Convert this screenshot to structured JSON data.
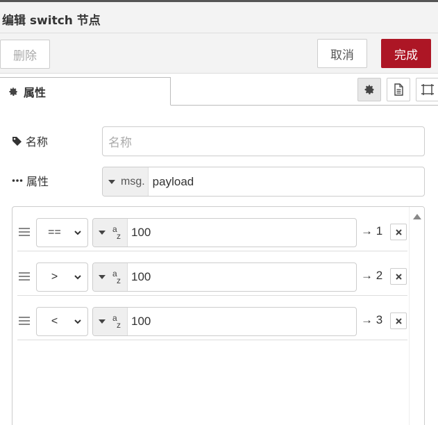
{
  "dialog": {
    "title": "编辑 switch 节点"
  },
  "toolbar": {
    "delete_label": "删除",
    "cancel_label": "取消",
    "done_label": "完成"
  },
  "tabs": {
    "properties_label": "属性"
  },
  "form": {
    "name_label": "名称",
    "name_placeholder": "名称",
    "property_label": "属性",
    "property_prefix": "msg.",
    "property_value": "payload"
  },
  "rules": [
    {
      "operator": "==",
      "type": "a-z",
      "value": "100",
      "output": "→ 1"
    },
    {
      "operator": ">",
      "type": "a-z",
      "value": "100",
      "output": "→ 2"
    },
    {
      "operator": "<",
      "type": "a-z",
      "value": "100",
      "output": "→ 3"
    }
  ],
  "icons": {
    "tab_gear": "gear-icon",
    "description": "document-icon",
    "appearance": "frame-icon",
    "name": "tag-icon",
    "property": "ellipsis-icon",
    "rule_delete": "close-icon"
  },
  "colors": {
    "primary": "#ad1625",
    "header_bg": "#f3f3f3"
  }
}
